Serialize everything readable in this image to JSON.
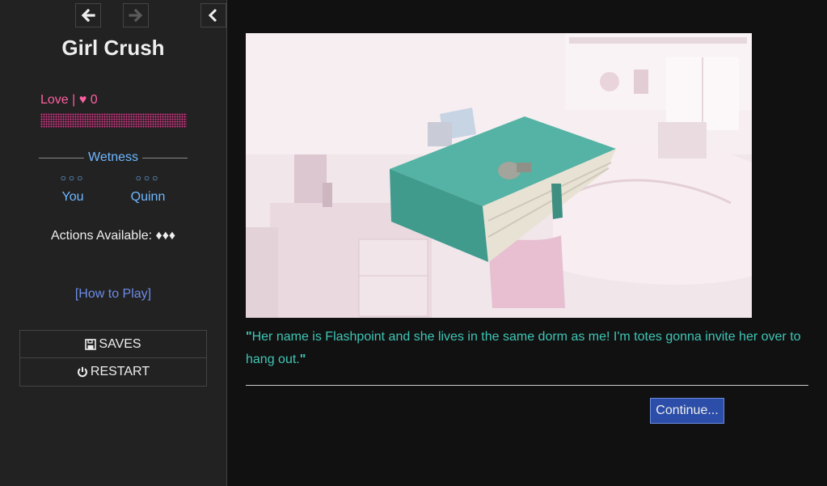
{
  "sidebar": {
    "title": "Girl Crush",
    "love": {
      "label": "Love | ♥ 0",
      "value": 0,
      "bar_color": "#ff5fa2"
    },
    "wetness": {
      "heading": "Wetness",
      "characters": [
        {
          "name": "You",
          "dots": "○○○",
          "level": 0
        },
        {
          "name": "Quinn",
          "dots": "○○○",
          "level": 0
        }
      ]
    },
    "actions_label": "Actions Available: ♦♦♦",
    "how_to_play": "[How to Play]",
    "menu": {
      "saves_label": "SAVES",
      "restart_label": "RESTART"
    },
    "icons": {
      "back": "arrow-left-icon",
      "forward": "arrow-right-icon",
      "stow": "chevron-left-icon",
      "saves": "floppy-disk-icon",
      "restart": "power-icon"
    }
  },
  "passage": {
    "quote_open": "\"",
    "dialogue": "Her name is Flashpoint and she lives in the same dorm as me! I'm totes gonna invite her over to hang out.",
    "quote_close": "\"",
    "continue_label": "Continue..."
  },
  "colors": {
    "background": "#111111",
    "sidebar": "#222222",
    "dialogue": "#3fc6b5",
    "link": "#6c8ce8",
    "wetness": "#6fb8ff",
    "love": "#ff5fa2",
    "button": "#2c4ea8"
  }
}
